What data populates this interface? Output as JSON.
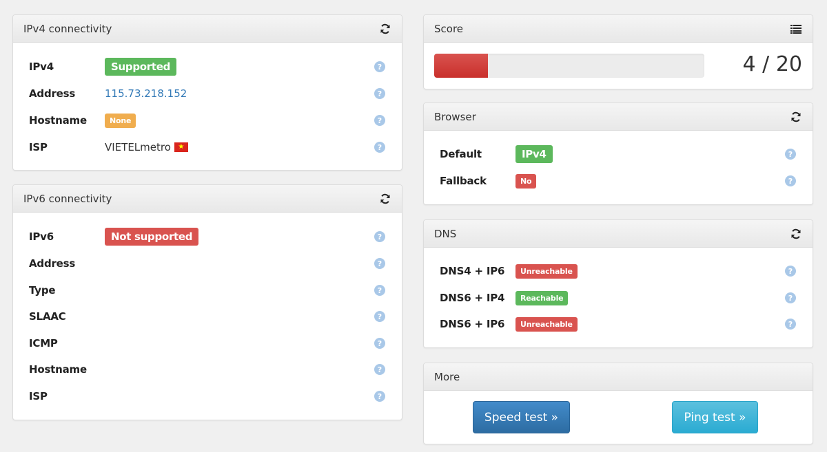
{
  "ipv4": {
    "title": "IPv4 connectivity",
    "rows": [
      {
        "label": "IPv4",
        "value": "Supported",
        "value_kind": "badge",
        "color": "#5cb85c"
      },
      {
        "label": "Address",
        "value": "115.73.218.152",
        "value_kind": "link"
      },
      {
        "label": "Hostname",
        "value": "None",
        "value_kind": "badge",
        "color": "#f0ad4e"
      },
      {
        "label": "ISP",
        "value": "VIETELmetro",
        "value_kind": "text",
        "flag": "vietnam-flag"
      }
    ]
  },
  "ipv6": {
    "title": "IPv6 connectivity",
    "rows": [
      {
        "label": "IPv6",
        "value": "Not supported",
        "value_kind": "badge",
        "color": "#d9534f"
      },
      {
        "label": "Address",
        "value": ""
      },
      {
        "label": "Type",
        "value": ""
      },
      {
        "label": "SLAAC",
        "value": ""
      },
      {
        "label": "ICMP",
        "value": ""
      },
      {
        "label": "Hostname",
        "value": ""
      },
      {
        "label": "ISP",
        "value": ""
      }
    ]
  },
  "score": {
    "title": "Score",
    "value": 4,
    "max": 20,
    "text": "4 / 20",
    "fraction": 0.2,
    "bar_color": "#d9534f"
  },
  "browser": {
    "title": "Browser",
    "rows": [
      {
        "label": "Default",
        "value": "IPv4",
        "color": "#5cb85c"
      },
      {
        "label": "Fallback",
        "value": "No",
        "color": "#d9534f"
      }
    ]
  },
  "dns": {
    "title": "DNS",
    "rows": [
      {
        "label": "DNS4 + IP6",
        "value": "Unreachable",
        "color": "#d9534f"
      },
      {
        "label": "DNS6 + IP4",
        "value": "Reachable",
        "color": "#5cb85c"
      },
      {
        "label": "DNS6 + IP6",
        "value": "Unreachable",
        "color": "#d9534f"
      }
    ]
  },
  "more": {
    "title": "More",
    "speed_test_label": "Speed test »",
    "ping_test_label": "Ping test »"
  },
  "icons": {
    "refresh": "refresh-icon",
    "list": "list-icon",
    "help": "help-icon",
    "help_glyph": "?"
  }
}
